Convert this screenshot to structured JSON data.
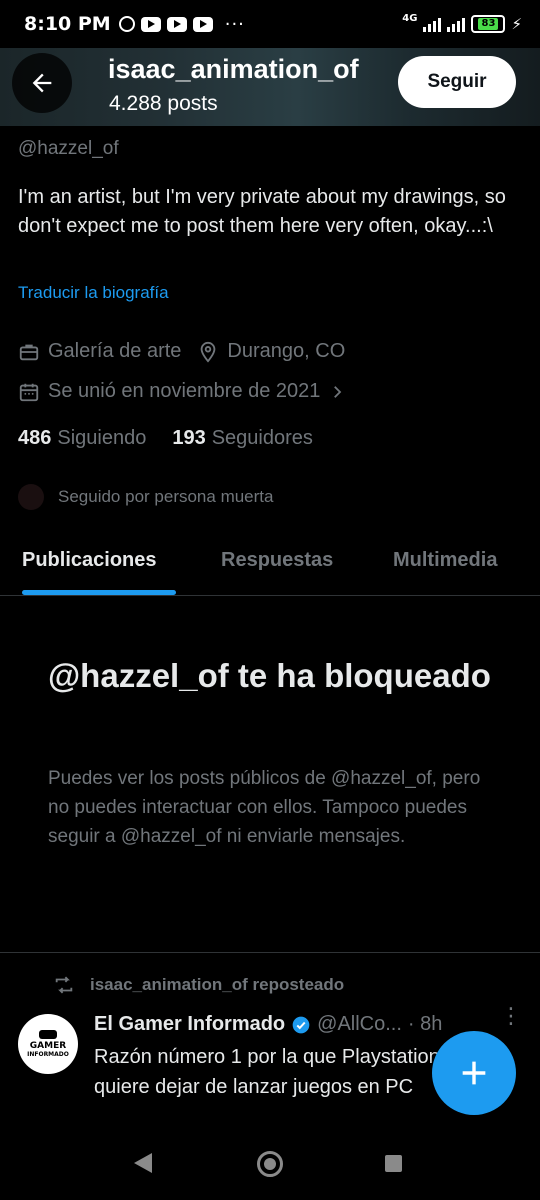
{
  "status_bar": {
    "time": "8:10 PM",
    "network": "4G",
    "battery": "83",
    "overflow": "···"
  },
  "header": {
    "title": "isaac_animation_of",
    "subtitle": "4.288 posts",
    "follow_label": "Seguir"
  },
  "profile": {
    "handle": "@hazzel_of",
    "bio": "I'm an artist, but I'm very private about my drawings, so don't expect me to post them here very often, okay...:\\",
    "translate_label": "Traducir la biografía",
    "category": "Galería de arte",
    "location": "Durango, CO",
    "joined": "Se unió en noviembre de 2021",
    "following_count": "486",
    "following_label": "Siguiendo",
    "followers_count": "193",
    "followers_label": "Seguidores",
    "followed_by": "Seguido por persona muerta"
  },
  "tabs": [
    {
      "label": "Publicaciones",
      "active": true
    },
    {
      "label": "Respuestas",
      "active": false
    },
    {
      "label": "Multimedia",
      "active": false
    }
  ],
  "blocked": {
    "title": "@hazzel_of te ha bloqueado",
    "text": "Puedes ver los posts públicos de @hazzel_of, pero no puedes interactuar con ellos. Tampoco puedes seguir a @hazzel_of ni enviarle mensajes."
  },
  "tweet": {
    "repost_label": "isaac_animation_of reposteado",
    "author_name": "El Gamer Informado",
    "author_handle": "@AllCo...",
    "time": "· 8h",
    "line1": "Razón número 1 por la que Playstation",
    "line2": "quiere dejar de lanzar juegos en PC",
    "avatar_top": "GAMER",
    "avatar_bottom": "INFORMADO"
  },
  "colors": {
    "accent": "#1d9bf0",
    "muted": "#71767b",
    "text": "#e7e9ea",
    "background": "#000000"
  },
  "icons": [
    "back-arrow-icon",
    "briefcase-icon",
    "location-pin-icon",
    "calendar-icon",
    "chevron-right-icon",
    "repost-icon",
    "verified-badge-icon",
    "more-icon",
    "plus-icon"
  ]
}
